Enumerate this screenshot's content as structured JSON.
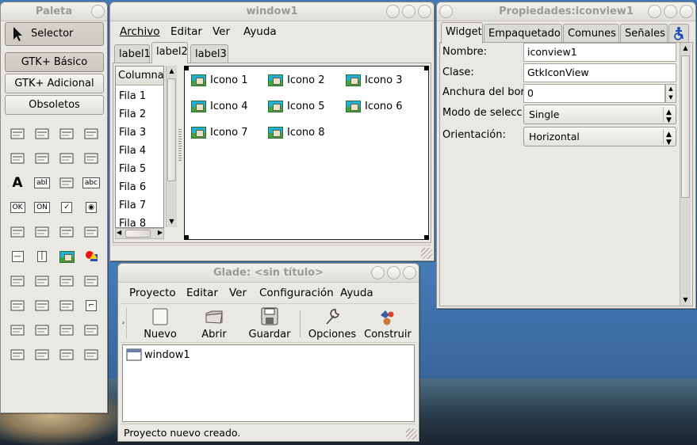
{
  "palette": {
    "title": "Paleta",
    "selector_label": "Selector",
    "groups": [
      "GTK+ Básico",
      "GTK+ Adicional",
      "Obsoletos"
    ],
    "widget_icons": [
      "window-icon",
      "menubar-icon",
      "toolbar-icon",
      "handlebox-icon",
      "button-box-icon",
      "toggle-icon",
      "radio-icon",
      "check-icon",
      "label-icon",
      "entry-icon",
      "combo-icon",
      "textview-icon",
      "button-icon",
      "toggle-button-icon",
      "check-button-icon",
      "radio-button-icon",
      "spin-button-icon",
      "combo-box-icon",
      "tree-icon",
      "icon-grid-icon",
      "hseparator-icon",
      "vseparator-icon",
      "image-icon",
      "drawing-icon",
      "calendar-icon",
      "filechooser-icon",
      "colorbutton-icon",
      "fontbutton-icon",
      "vbox-icon",
      "hbox-icon",
      "table-icon",
      "fixed-icon",
      "hpaned-icon",
      "vpaned-icon",
      "notebook-icon",
      "scale-icon",
      "frame-icon",
      "aspectframe-icon",
      "alignment-icon",
      "ruler-icon"
    ]
  },
  "window1": {
    "title": "window1",
    "menu": [
      "Archivo",
      "Editar",
      "Ver",
      "Ayuda"
    ],
    "tabs": [
      "label1",
      "label2",
      "label3"
    ],
    "active_tab": "label2",
    "tree": {
      "column_header": "Columna",
      "rows": [
        "Fila 1",
        "Fila 2",
        "Fila 3",
        "Fila 4",
        "Fila 5",
        "Fila 6",
        "Fila 7",
        "Fila 8"
      ]
    },
    "iconview": {
      "items": [
        "Icono 1",
        "Icono 2",
        "Icono 3",
        "Icono 4",
        "Icono 5",
        "Icono 6",
        "Icono 7",
        "Icono 8"
      ]
    }
  },
  "properties": {
    "title": "Propiedades:iconview1",
    "tabs": [
      "Widget",
      "Empaquetado",
      "Comunes",
      "Señales"
    ],
    "active_tab": "Widget",
    "fields": {
      "name_label": "Nombre:",
      "name_value": "iconview1",
      "class_label": "Clase:",
      "class_value": "GtkIconView",
      "border_label": "Anchura del bor",
      "border_value": "0",
      "selection_label": "Modo de selecc",
      "selection_value": "Single",
      "orientation_label": "Orientación:",
      "orientation_value": "Horizontal"
    }
  },
  "glade": {
    "title": "Glade: <sin título>",
    "menu": [
      "Proyecto",
      "Editar",
      "Ver",
      "Configuración",
      "Ayuda"
    ],
    "toolbar": [
      "Nuevo",
      "Abrir",
      "Guardar",
      "Opciones",
      "Construir"
    ],
    "project_items": [
      "window1"
    ],
    "status": "Proyecto nuevo creado."
  }
}
